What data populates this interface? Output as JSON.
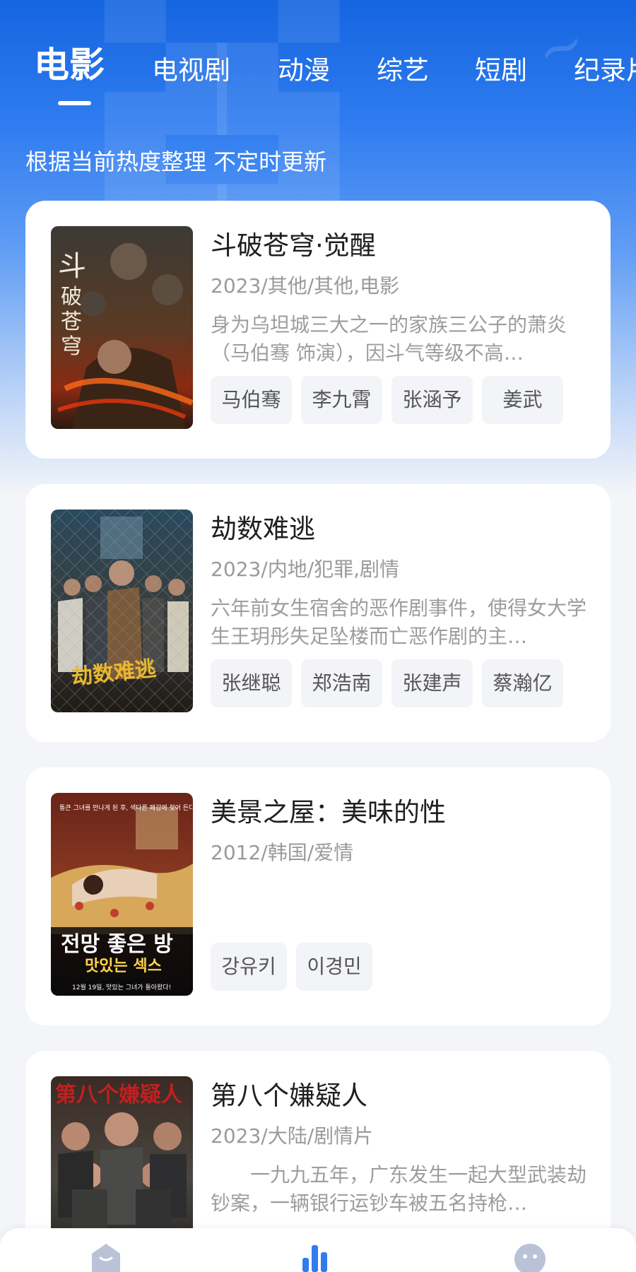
{
  "tabs": [
    {
      "label": "电影",
      "active": true
    },
    {
      "label": "电视剧",
      "active": false
    },
    {
      "label": "动漫",
      "active": false
    },
    {
      "label": "综艺",
      "active": false
    },
    {
      "label": "短剧",
      "active": false
    },
    {
      "label": "纪录片",
      "active": false
    }
  ],
  "subtitle": "根据当前热度整理 不定时更新",
  "movies": [
    {
      "title": "斗破苍穹·觉醒",
      "meta": "2023/其他/其他,电影",
      "description": "身为乌坦城三大之一的家族三公子的萧炎（马伯骞 饰演），因斗气等级不高…",
      "cast": [
        "马伯骞",
        "李九霄",
        "张涵予",
        "姜武"
      ]
    },
    {
      "title": "劫数难逃",
      "meta": "2023/内地/犯罪,剧情",
      "description": "六年前女生宿舍的恶作剧事件，使得女大学生王玥彤失足坠楼而亡恶作剧的主…",
      "cast": [
        "张继聪",
        "郑浩南",
        "张建声",
        "蔡瀚亿"
      ]
    },
    {
      "title": "美景之屋：美味的性",
      "meta": "2012/韩国/爱情",
      "description": "",
      "cast": [
        "강유키",
        "이경민"
      ]
    },
    {
      "title": "第八个嫌疑人",
      "meta": "2023/大陆/剧情片",
      "description": "　　一九九五年，广东发生一起大型武装劫钞案，一辆银行运钞车被五名持枪…",
      "cast": []
    }
  ],
  "posters": {
    "poster_1_text": "斗破苍穹",
    "poster_2_text": "劫数难逃",
    "poster_3_text_top": "통큰 그녀를 만나게 된 후, 색다른 페감에 젖어 든다!",
    "poster_3_text_main": "전망 좋은 방",
    "poster_3_text_sub": "맛있는 섹스",
    "poster_3_text_bottom": "12월 19일, 맛있는 그녀가 돌아왔다!",
    "poster_4_text": "第八个嫌疑人"
  },
  "bottom_nav": [
    {
      "icon": "home-icon"
    },
    {
      "icon": "ranking-icon"
    },
    {
      "icon": "profile-icon"
    }
  ],
  "colors": {
    "brand_blue": "#1565e0",
    "accent_blue": "#2f7cf0",
    "page_bg": "#f3f5f9"
  }
}
